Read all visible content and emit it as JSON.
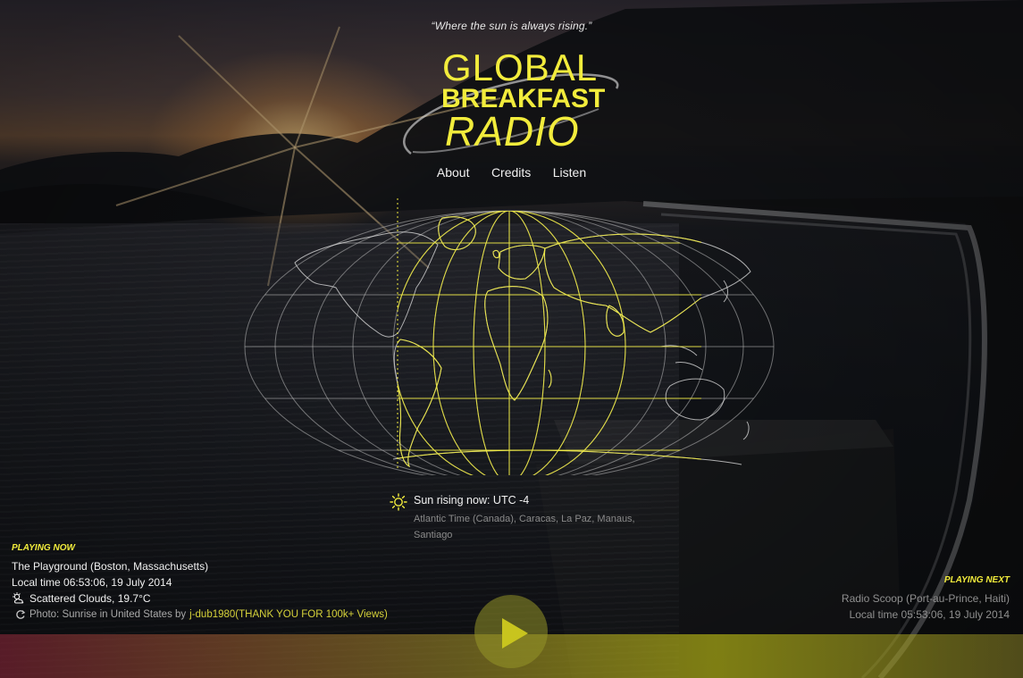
{
  "header": {
    "tagline": "“Where the sun is always rising.”",
    "logo": {
      "line1": "GLOBAL",
      "line2": "BREAKFAST",
      "line3": "RADIO"
    }
  },
  "nav": {
    "items": [
      {
        "label": "About"
      },
      {
        "label": "Credits"
      },
      {
        "label": "Listen"
      }
    ]
  },
  "sun": {
    "icon": "sun-icon",
    "headline": "Sun rising now: UTC -4",
    "zones": "Atlantic Time (Canada), Caracas, La Paz, Manaus, Santiago"
  },
  "playing_now": {
    "label": "PLAYING NOW",
    "station": "The Playground (Boston, Massachusetts)",
    "local_time": "Local time 06:53:06, 19 July 2014",
    "weather_icon": "cloud-sun-icon",
    "weather": "Scattered Clouds, 19.7°C",
    "credit_icon": "refresh-icon",
    "credit_text": "Photo: Sunrise in United States by",
    "credit_link": "j-dub1980(THANK YOU FOR 100k+ Views)"
  },
  "playing_next": {
    "label": "PLAYING NEXT",
    "station": "Radio Scoop (Port-au-Prince, Haiti)",
    "local_time": "Local time 05:53:06, 19 July 2014"
  },
  "player": {
    "play_icon": "play-icon"
  },
  "colors": {
    "accent": "#f2ec3c",
    "text": "#f0f0f0",
    "muted": "#8a8a8a"
  }
}
